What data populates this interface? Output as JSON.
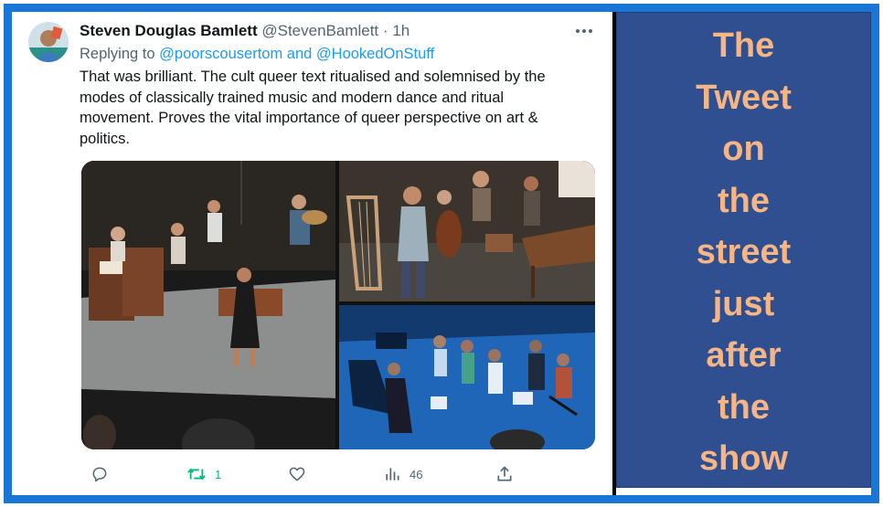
{
  "tweet": {
    "author_name": "Steven Douglas Bamlett",
    "author_handle": "@StevenBamlett",
    "separator": "·",
    "time": "1h",
    "replying_prefix": "Replying to",
    "replying_mentions": "@poorscousertom and @HookedOnStuff",
    "text": "That was brilliant. The cult queer text ritualised and solemnised by the modes of classically trained music and modern dance and ritual movement. Proves the vital importance of queer perspective on art & politics.",
    "more_icon": "more-horizontal-icon",
    "actions": {
      "reply": {
        "icon": "reply-icon",
        "count": ""
      },
      "retweet": {
        "icon": "retweet-icon",
        "count": "1",
        "color": "#00ba7c"
      },
      "like": {
        "icon": "heart-icon",
        "count": ""
      },
      "views": {
        "icon": "views-chart-icon",
        "count": "46"
      },
      "share": {
        "icon": "share-icon",
        "count": ""
      }
    },
    "mention_color": "#1d9bf0"
  },
  "caption": {
    "text": "The Tweet on the street just after the show",
    "color": "#f5b585",
    "background": "#2f4f91"
  },
  "frame_color": "#1877d6"
}
